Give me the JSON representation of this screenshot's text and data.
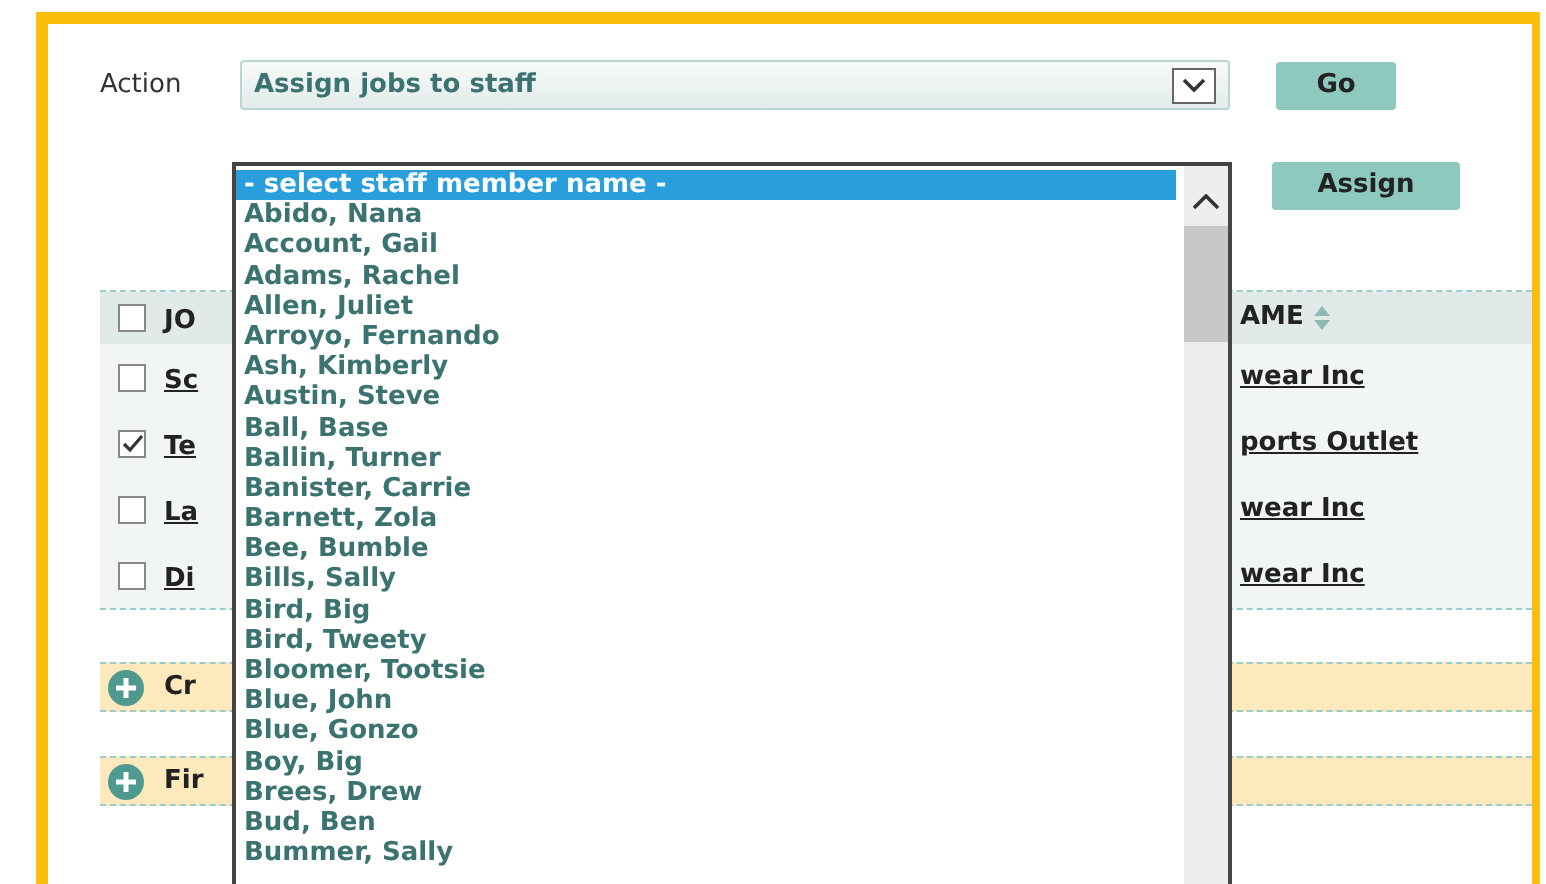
{
  "action": {
    "label": "Action",
    "value": "Assign jobs to staff"
  },
  "go_button": "Go",
  "assign_button": "Assign",
  "staff_list": [
    {
      "name": "- select staff member name -",
      "selected": true
    },
    {
      "name": "Abido, Nana",
      "selected": false
    },
    {
      "name": "Account, Gail",
      "selected": false
    },
    {
      "name": "Adams, Rachel",
      "selected": false
    },
    {
      "name": "Allen, Juliet",
      "selected": false
    },
    {
      "name": "Arroyo, Fernando",
      "selected": false
    },
    {
      "name": "Ash, Kimberly",
      "selected": false
    },
    {
      "name": "Austin, Steve",
      "selected": false
    },
    {
      "name": "Ball, Base",
      "selected": false
    },
    {
      "name": "Ballin, Turner",
      "selected": false
    },
    {
      "name": "Banister, Carrie",
      "selected": false
    },
    {
      "name": "Barnett, Zola",
      "selected": false
    },
    {
      "name": "Bee, Bumble",
      "selected": false
    },
    {
      "name": "Bills, Sally",
      "selected": false
    },
    {
      "name": "Bird, Big",
      "selected": false
    },
    {
      "name": "Bird, Tweety",
      "selected": false
    },
    {
      "name": "Bloomer, Tootsie",
      "selected": false
    },
    {
      "name": "Blue, John",
      "selected": false
    },
    {
      "name": "Blue, Gonzo",
      "selected": false
    },
    {
      "name": "Boy, Big",
      "selected": false
    },
    {
      "name": "Brees, Drew",
      "selected": false
    },
    {
      "name": "Bud, Ben",
      "selected": false
    },
    {
      "name": "Bummer, Sally",
      "selected": false
    }
  ],
  "table": {
    "header": {
      "checked": false,
      "column_1": "JO",
      "column_2": "AME"
    },
    "rows": [
      {
        "checked": false,
        "column_1": "Sc",
        "column_2": "wear Inc"
      },
      {
        "checked": true,
        "column_1": "Te",
        "column_2": "ports Outlet"
      },
      {
        "checked": false,
        "column_1": "La",
        "column_2": "wear Inc"
      },
      {
        "checked": false,
        "column_1": "Di",
        "column_2": "wear Inc"
      }
    ]
  },
  "panels": [
    {
      "title": "Cr"
    },
    {
      "title": "Fir"
    }
  ]
}
